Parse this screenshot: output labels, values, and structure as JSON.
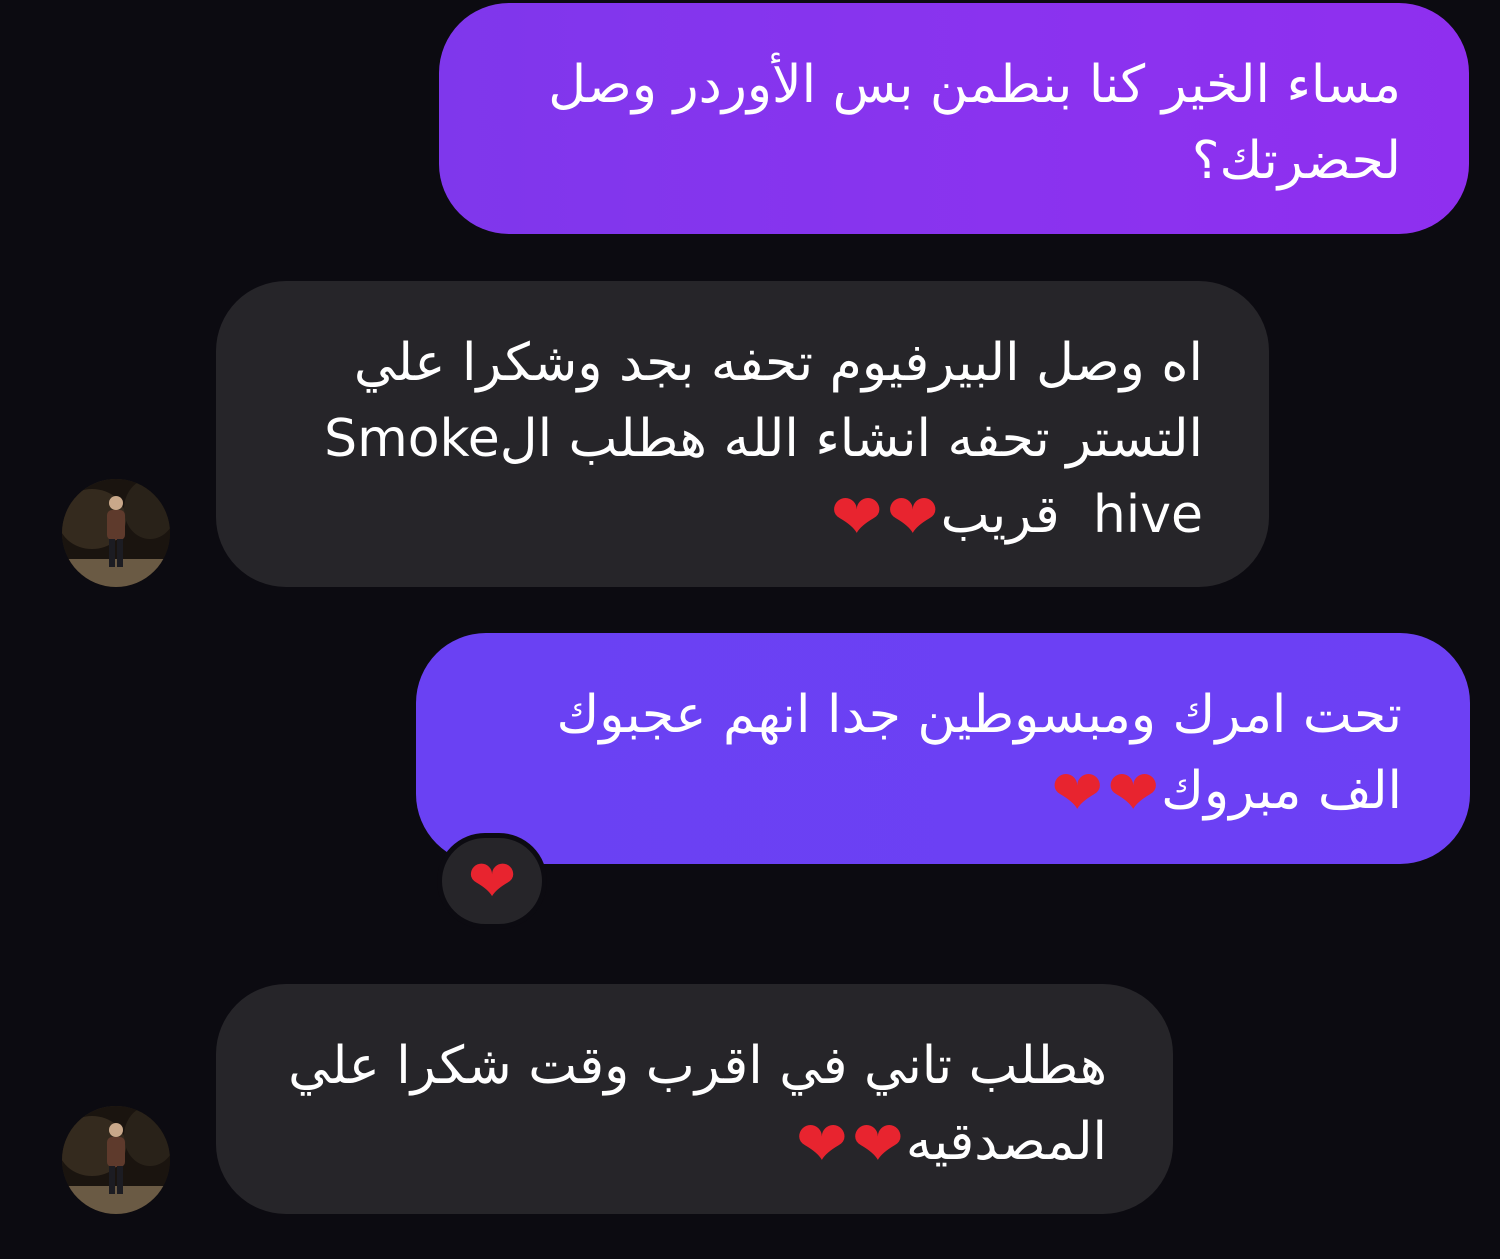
{
  "conversation": {
    "messages": [
      {
        "direction": "outgoing",
        "lines": [
          "مساء الخير كنا بنطمن بس الأوردر وصل",
          "لحضرتك؟"
        ]
      },
      {
        "direction": "incoming",
        "lines": [
          "اه وصل البيرفيوم تحفه بجد وشكرا علي",
          "التستر تحفه انشاء الله هطلب الSmoke",
          "hive",
          "قريب"
        ],
        "emoji": [
          "❤",
          "❤"
        ]
      },
      {
        "direction": "outgoing",
        "lines": [
          "تحت امرك ومبسوطين جدا انهم عجبوك",
          "الف مبروك"
        ],
        "emoji": [
          "❤",
          "❤"
        ],
        "reaction": "❤"
      },
      {
        "direction": "incoming",
        "lines": [
          "هطلب تاني في اقرب وقت شكرا علي",
          "المصدقيه"
        ],
        "emoji": [
          "❤",
          "❤"
        ]
      }
    ]
  },
  "colors": {
    "background": "#0c0b11",
    "outgoing_bubble_1": "#8a33ef",
    "outgoing_bubble_2": "#6c40f4",
    "incoming_bubble": "#262529",
    "heart": "#e8242f"
  },
  "icons": {
    "avatar": "contact-avatar-photo",
    "reaction": "red-heart-icon"
  }
}
